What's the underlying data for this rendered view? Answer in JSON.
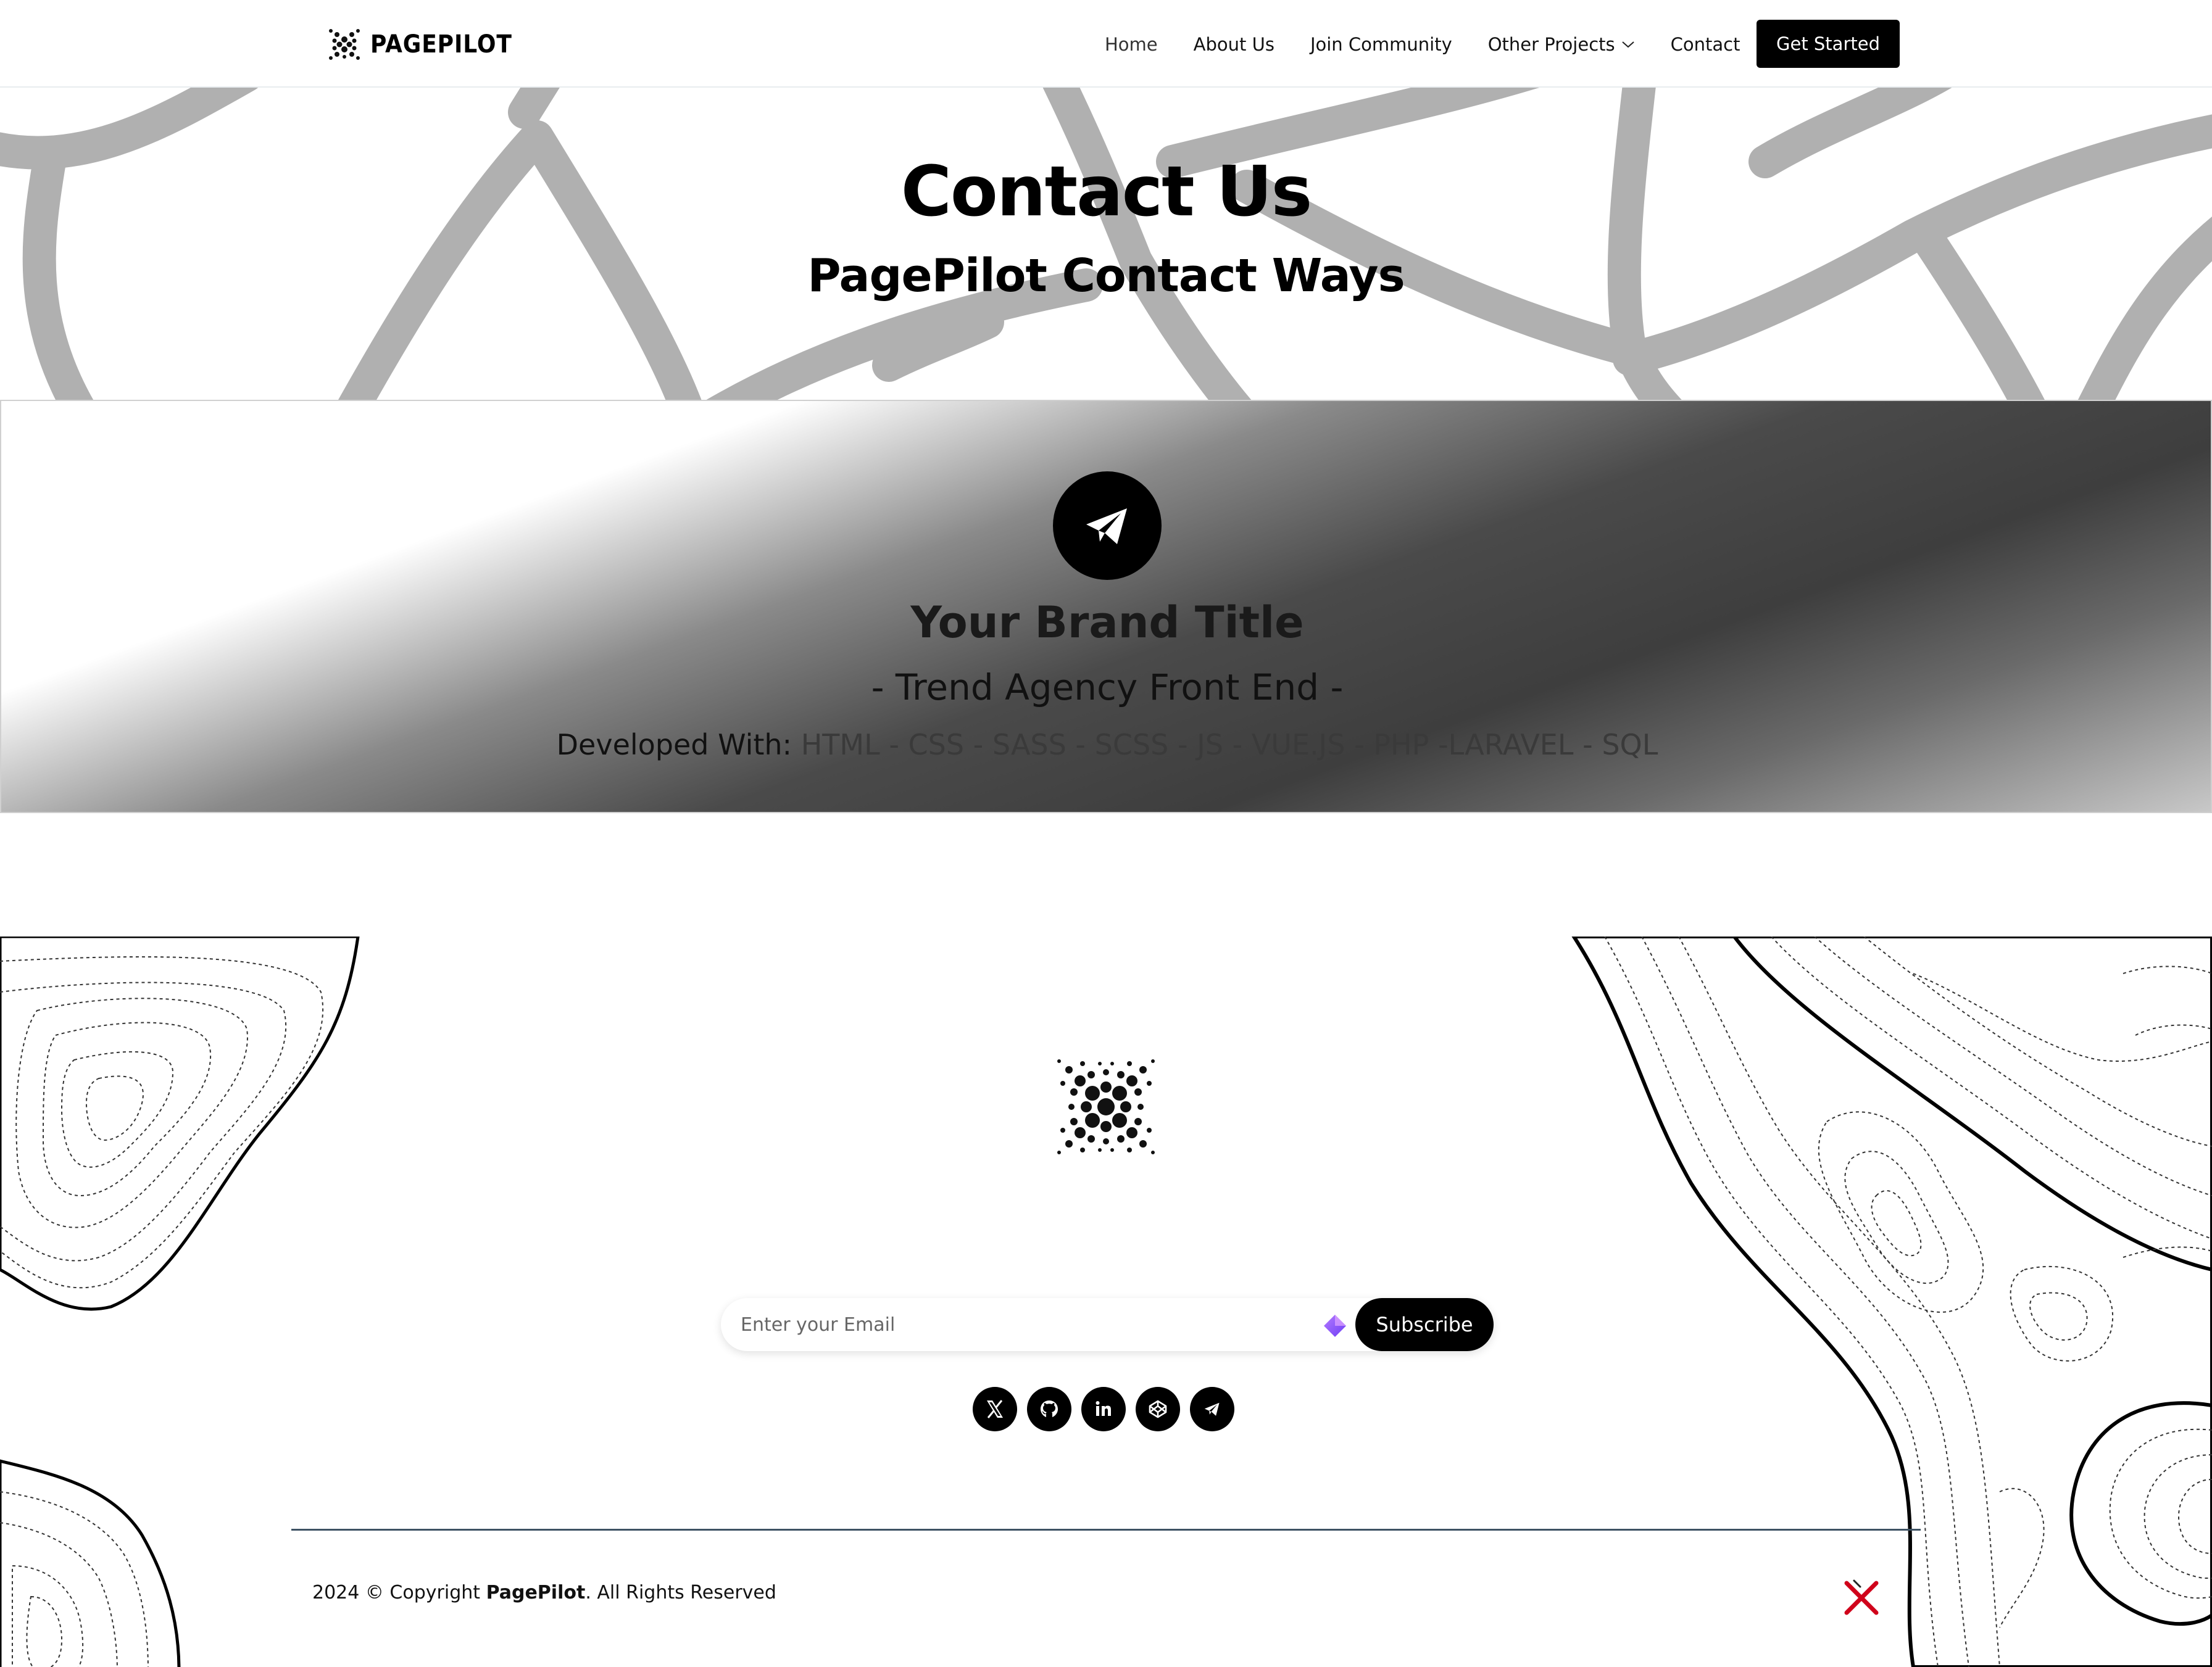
{
  "nav": {
    "brand": "PAGEPILOT",
    "links": [
      "Home",
      "About Us",
      "Join Community",
      "Other Projects",
      "Contact"
    ],
    "cta": "Get Started"
  },
  "hero": {
    "title": "Contact Us",
    "subtitle": "PagePilot Contact Ways"
  },
  "brand_card": {
    "icon": "telegram-icon",
    "title": "Your Brand Title",
    "tagline": "- Trend Agency Front End -",
    "tech_label": "Developed With:",
    "tech_list": "HTML - CSS - SASS - SCSS - JS - VUE.JS - PHP -LARAVEL - SQL"
  },
  "footer": {
    "email_placeholder": "Enter your Email",
    "subscribe": "Subscribe",
    "socials": [
      "x-icon",
      "github-icon",
      "linkedin-icon",
      "codepen-icon",
      "telegram-icon"
    ],
    "copyright_prefix": "2024 © Copyright",
    "copyright_brand": "PagePilot",
    "copyright_suffix": ". All Rights Reserved"
  },
  "colors": {
    "primary": "#000000",
    "background": "#ffffff",
    "hero_pattern": "#b0b0b0",
    "divider": "#3e5263",
    "close_icon": "#d0021b"
  }
}
